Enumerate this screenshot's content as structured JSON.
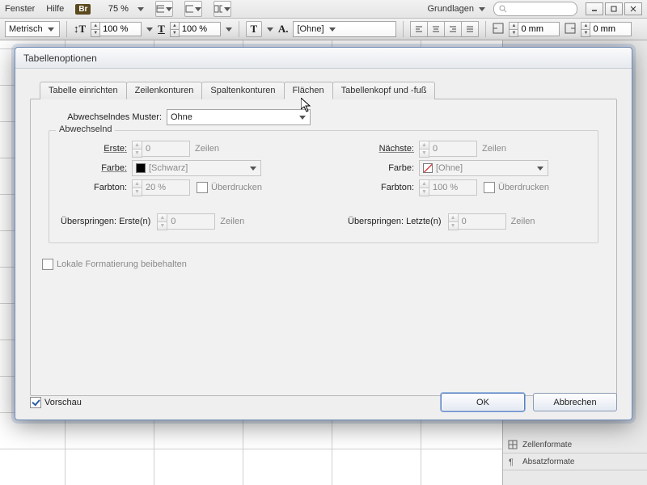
{
  "menu": {
    "fenster": "Fenster",
    "hilfe": "Hilfe",
    "br": "Br",
    "zoom": "75 %",
    "workspace": "Grundlagen"
  },
  "ctrl": {
    "units": "Metrisch",
    "scaleH": "100 %",
    "scaleV": "100 %",
    "charStyle": "[Ohne]",
    "insetL": "0 mm",
    "insetR": "0 mm"
  },
  "dialog": {
    "title": "Tabellenoptionen",
    "tabs": {
      "t1": "Tabelle einrichten",
      "t2": "Zeilenkonturen",
      "t3": "Spaltenkonturen",
      "t4": "Flächen",
      "t5": "Tabellenkopf und -fuß"
    },
    "patternLabel": "Abwechselndes Muster:",
    "patternValue": "Ohne",
    "groupTitle": "Abwechselnd",
    "left": {
      "ersteLbl": "Erste:",
      "ersteVal": "0",
      "zeilen": "Zeilen",
      "farbeLbl": "Farbe:",
      "farbeVal": "[Schwarz]",
      "farbtonLbl": "Farbton:",
      "farbtonVal": "20 %",
      "ueberdrucken": "Überdrucken"
    },
    "right": {
      "naechsteLbl": "Nächste:",
      "naechsteVal": "0",
      "zeilen": "Zeilen",
      "farbeLbl": "Farbe:",
      "farbeVal": "[Ohne]",
      "farbtonLbl": "Farbton:",
      "farbtonVal": "100 %",
      "ueberdrucken": "Überdrucken"
    },
    "skipFirst": {
      "lbl": "Überspringen: Erste(n)",
      "val": "0",
      "suf": "Zeilen"
    },
    "skipLast": {
      "lbl": "Überspringen: Letzte(n)",
      "val": "0",
      "suf": "Zeilen"
    },
    "preserveLocal": "Lokale Formatierung beibehalten",
    "preview": "Vorschau",
    "ok": "OK",
    "cancel": "Abbrechen"
  },
  "panels": {
    "zellenformate": "Zellenformate",
    "absatzformate": "Absatzformate"
  }
}
